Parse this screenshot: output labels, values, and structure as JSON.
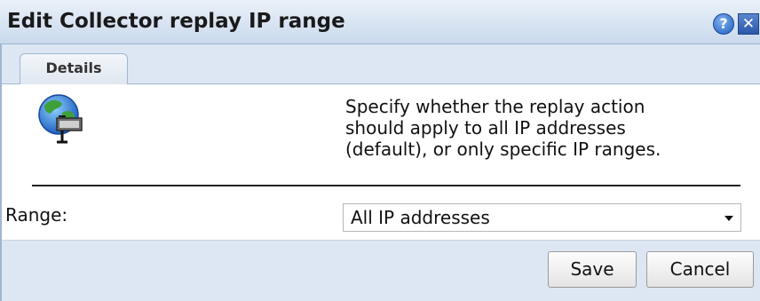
{
  "dialog": {
    "title": "Edit Collector replay IP range",
    "help_glyph": "?",
    "close_glyph": "✕"
  },
  "tabs": [
    {
      "label": "Details",
      "selected": true
    }
  ],
  "content": {
    "icon": "globe-network-icon",
    "description_lines": [
      "Specify whether the replay action",
      "should apply to all IP addresses",
      "(default), or only specific IP ranges."
    ],
    "range_label": "Range:",
    "range_value": "All IP addresses"
  },
  "footer": {
    "save_label": "Save",
    "cancel_label": "Cancel"
  },
  "colors": {
    "titlebar": "#c9d9ec",
    "panel": "#dde7f3",
    "accent": "#1e5fbf"
  }
}
